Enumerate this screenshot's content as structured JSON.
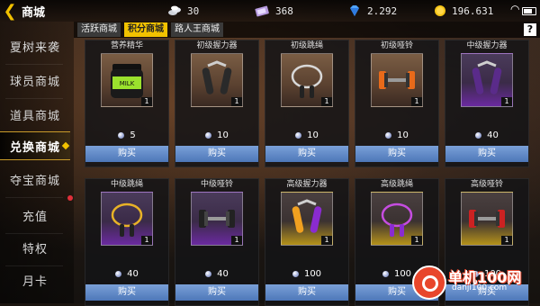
{
  "header": {
    "title": "商城"
  },
  "currencies": [
    {
      "icon": "coin-stack-icon",
      "value": "30"
    },
    {
      "icon": "ticket-icon",
      "value": "368"
    },
    {
      "icon": "diamond-icon",
      "value": "2.292"
    },
    {
      "icon": "gold-coin-icon",
      "value": "196.631"
    }
  ],
  "sidebar": {
    "items": [
      {
        "label": "夏树来袭"
      },
      {
        "label": "球员商城"
      },
      {
        "label": "道具商城"
      },
      {
        "label": "兑换商城"
      },
      {
        "label": "夺宝商城"
      },
      {
        "label": "充值"
      },
      {
        "label": "特权"
      },
      {
        "label": "月卡"
      }
    ],
    "active_index": 3
  },
  "tabs": [
    {
      "label": "活跃商城"
    },
    {
      "label": "积分商城"
    },
    {
      "label": "路人王商城"
    }
  ],
  "help_label": "?",
  "items": [
    {
      "name": "营养精华",
      "price": "5",
      "qty": "1",
      "buy": "购买",
      "icon": "supplement-tub-icon",
      "rarity": "normal"
    },
    {
      "name": "初级握力器",
      "price": "10",
      "qty": "1",
      "buy": "购买",
      "icon": "hand-grip-icon",
      "rarity": "normal"
    },
    {
      "name": "初级跳绳",
      "price": "10",
      "qty": "1",
      "buy": "购买",
      "icon": "jump-rope-icon",
      "rarity": "normal"
    },
    {
      "name": "初级哑铃",
      "price": "10",
      "qty": "1",
      "buy": "购买",
      "icon": "dumbbell-icon",
      "rarity": "normal"
    },
    {
      "name": "中级握力器",
      "price": "40",
      "qty": "1",
      "buy": "购买",
      "icon": "hand-grip-icon",
      "rarity": "purple"
    },
    {
      "name": "中级跳绳",
      "price": "40",
      "qty": "1",
      "buy": "购买",
      "icon": "jump-rope-icon",
      "rarity": "purple"
    },
    {
      "name": "中级哑铃",
      "price": "40",
      "qty": "1",
      "buy": "购买",
      "icon": "dumbbell-icon",
      "rarity": "purple"
    },
    {
      "name": "高级握力器",
      "price": "100",
      "qty": "1",
      "buy": "购买",
      "icon": "hand-grip-icon",
      "rarity": "gold"
    },
    {
      "name": "高级跳绳",
      "price": "100",
      "qty": "1",
      "buy": "购买",
      "icon": "jump-rope-icon",
      "rarity": "gold"
    },
    {
      "name": "高级哑铃",
      "price": "100",
      "qty": "1",
      "buy": "购买",
      "icon": "dumbbell-icon",
      "rarity": "gold"
    }
  ],
  "watermark": {
    "title": "单机100网",
    "sub": "danji100.com"
  }
}
